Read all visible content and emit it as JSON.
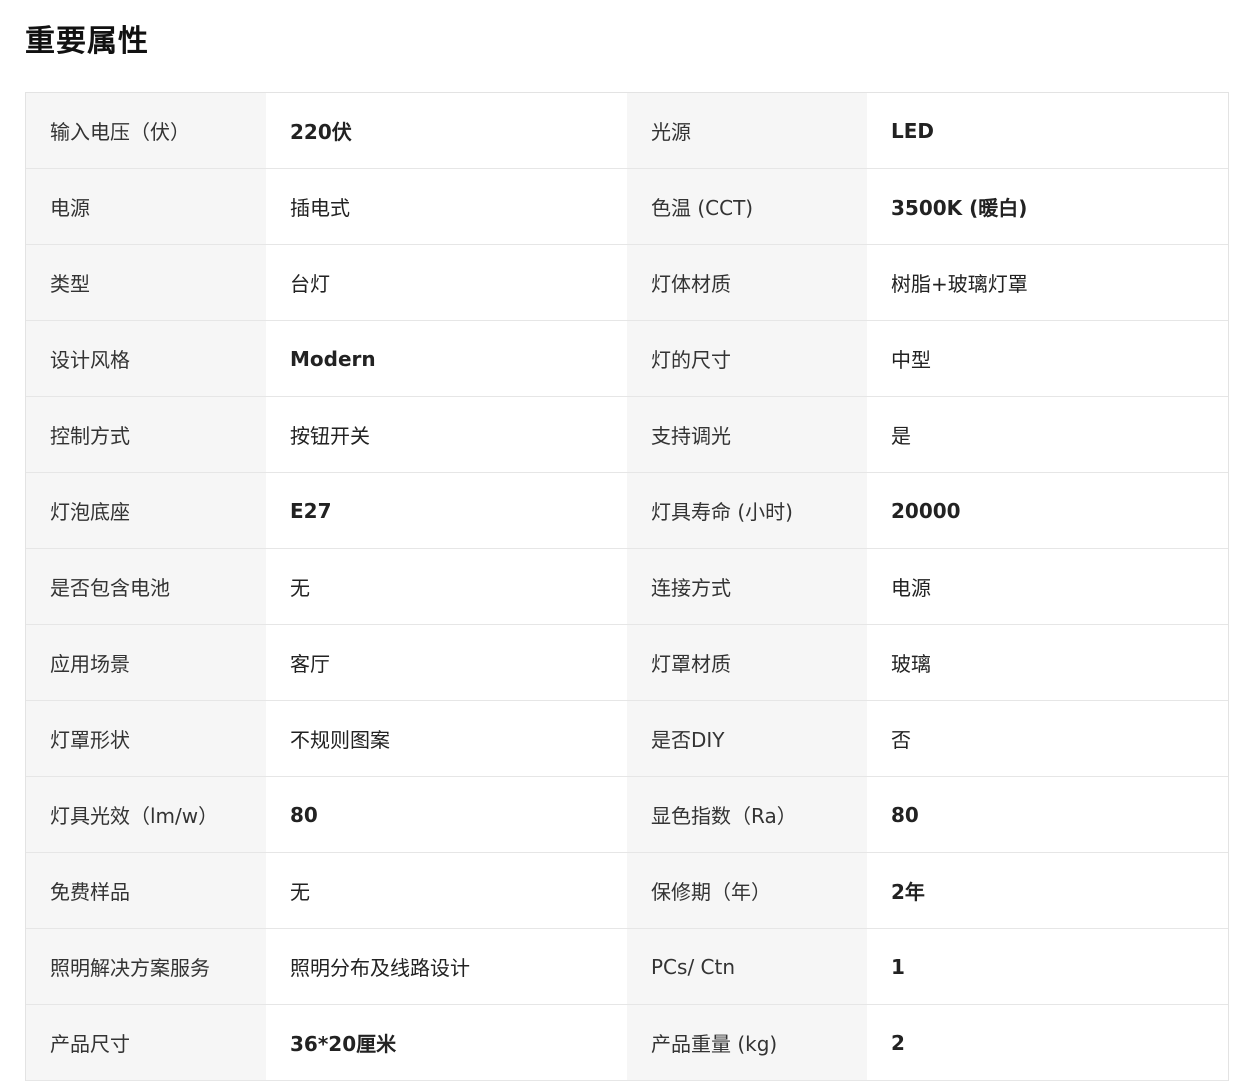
{
  "section": {
    "title": "重要属性"
  },
  "rows": [
    {
      "l1": "输入电压（伏）",
      "v1": "220伏",
      "l2": "光源",
      "v2": "LED"
    },
    {
      "l1": "电源",
      "v1": "插电式",
      "l2": "色温 (CCT)",
      "v2": "3500K (暖白)"
    },
    {
      "l1": "类型",
      "v1": "台灯",
      "l2": "灯体材质",
      "v2": "树脂+玻璃灯罩"
    },
    {
      "l1": "设计风格",
      "v1": "Modern",
      "l2": "灯的尺寸",
      "v2": "中型"
    },
    {
      "l1": "控制方式",
      "v1": "按钮开关",
      "l2": "支持调光",
      "v2": "是"
    },
    {
      "l1": "灯泡底座",
      "v1": "E27",
      "l2": "灯具寿命 (小时)",
      "v2": "20000"
    },
    {
      "l1": "是否包含电池",
      "v1": "无",
      "l2": "连接方式",
      "v2": "电源"
    },
    {
      "l1": "应用场景",
      "v1": "客厅",
      "l2": "灯罩材质",
      "v2": "玻璃"
    },
    {
      "l1": "灯罩形状",
      "v1": "不规则图案",
      "l2": "是否DIY",
      "v2": "否"
    },
    {
      "l1": "灯具光效（lm/w）",
      "v1": "80",
      "l2": "显色指数（Ra）",
      "v2": "80"
    },
    {
      "l1": "免费样品",
      "v1": "无",
      "l2": "保修期（年）",
      "v2": "2年"
    },
    {
      "l1": "照明解决方案服务",
      "v1": "照明分布及线路设计",
      "l2": "PCs/ Ctn",
      "v2": "1"
    },
    {
      "l1": "产品尺寸",
      "v1": "36*20厘米",
      "l2": "产品重量 (kg)",
      "v2": "2"
    }
  ]
}
